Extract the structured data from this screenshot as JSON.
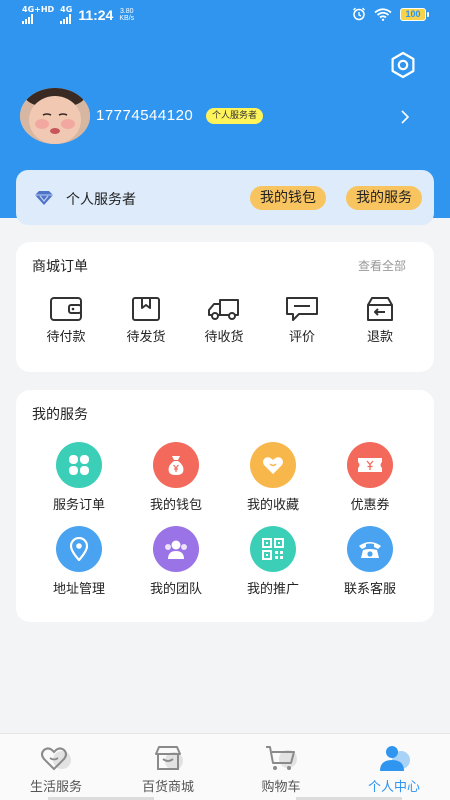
{
  "status_bar": {
    "network_1": "4G+HD",
    "network_2": "4G",
    "time": "11:24",
    "speed_value": "3.80",
    "speed_unit": "KB/s",
    "battery": "100"
  },
  "profile": {
    "phone": "17774544120",
    "role_badge": "个人服务者"
  },
  "service_bar": {
    "label": "个人服务者",
    "wallet_button": "我的钱包",
    "service_button": "我的服务"
  },
  "orders": {
    "title": "商城订单",
    "view_all": "查看全部",
    "items": [
      {
        "label": "待付款",
        "icon": "wallet-icon"
      },
      {
        "label": "待发货",
        "icon": "box-icon"
      },
      {
        "label": "待收货",
        "icon": "truck-icon"
      },
      {
        "label": "评价",
        "icon": "comment-icon"
      },
      {
        "label": "退款",
        "icon": "refund-icon"
      }
    ]
  },
  "services": {
    "title": "我的服务",
    "items": [
      {
        "label": "服务订单",
        "icon": "clover-icon",
        "color": "#3ccfb8"
      },
      {
        "label": "我的钱包",
        "icon": "money-bag-icon",
        "color": "#f36a5c"
      },
      {
        "label": "我的收藏",
        "icon": "heart-icon",
        "color": "#f8b74b"
      },
      {
        "label": "优惠券",
        "icon": "coupon-icon",
        "color": "#f36a5c"
      },
      {
        "label": "地址管理",
        "icon": "location-pin-icon",
        "color": "#4aa3f0"
      },
      {
        "label": "我的团队",
        "icon": "team-icon",
        "color": "#9a73e6"
      },
      {
        "label": "我的推广",
        "icon": "qr-code-icon",
        "color": "#3ccfb8"
      },
      {
        "label": "联系客服",
        "icon": "telephone-icon",
        "color": "#4aa3f0"
      }
    ]
  },
  "bottom_nav": {
    "items": [
      {
        "label": "生活服务",
        "icon": "heart-outline-icon"
      },
      {
        "label": "百货商城",
        "icon": "store-icon"
      },
      {
        "label": "购物车",
        "icon": "cart-icon"
      },
      {
        "label": "个人中心",
        "icon": "person-icon"
      }
    ],
    "active": "个人中心"
  },
  "colors": {
    "primary": "#2f95ef",
    "pill": "#f8c460",
    "badge": "#fff35a",
    "service_bar_bg": "#deebfb"
  }
}
